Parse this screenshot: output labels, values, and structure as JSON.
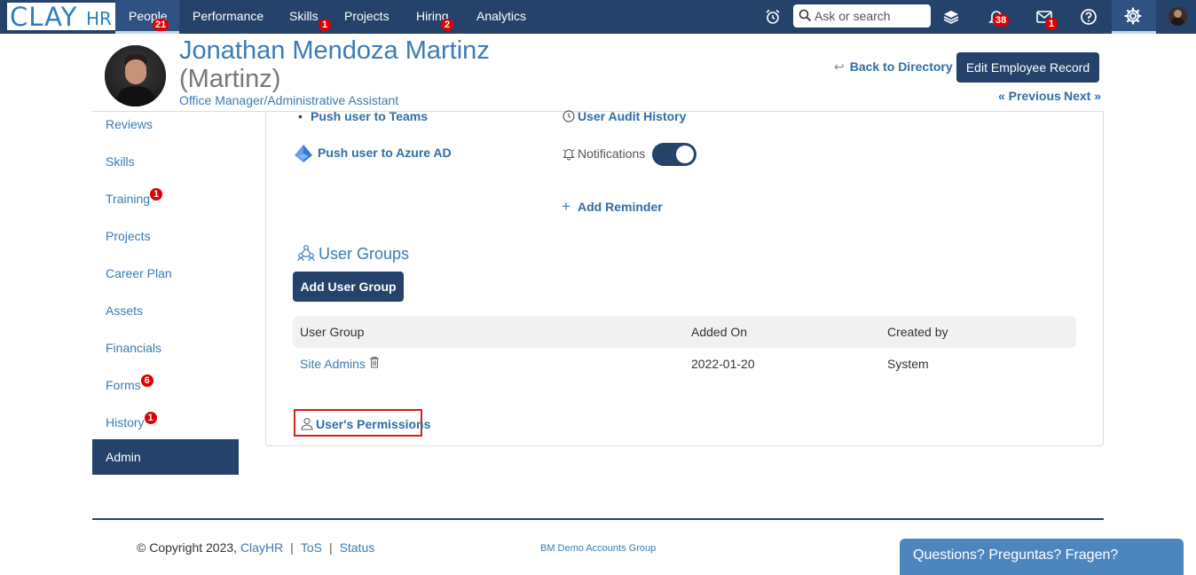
{
  "brand": {
    "clay": "CLAY",
    "hr": "HR"
  },
  "nav": {
    "items": [
      {
        "label": "People",
        "badge": "21"
      },
      {
        "label": "Performance",
        "badge": ""
      },
      {
        "label": "Skills",
        "badge": "1"
      },
      {
        "label": "Projects",
        "badge": ""
      },
      {
        "label": "Hiring",
        "badge": "2"
      },
      {
        "label": "Analytics",
        "badge": ""
      }
    ],
    "search_placeholder": "Ask or search",
    "notifications_badge": "38",
    "messages_badge": "1"
  },
  "employee": {
    "name": "Jonathan Mendoza Martinz",
    "nickname": "(Martinz)",
    "title": "Office Manager/Administrative Assistant"
  },
  "header_actions": {
    "back": "Back to Directory",
    "edit": "Edit Employee Record",
    "previous": "« Previous",
    "next": "Next »"
  },
  "sidebar": {
    "items": [
      {
        "label": "Reviews",
        "badge": ""
      },
      {
        "label": "Skills",
        "badge": ""
      },
      {
        "label": "Training",
        "badge": "1"
      },
      {
        "label": "Projects",
        "badge": ""
      },
      {
        "label": "Career Plan",
        "badge": ""
      },
      {
        "label": "Assets",
        "badge": ""
      },
      {
        "label": "Financials",
        "badge": ""
      },
      {
        "label": "Forms",
        "badge": "6"
      },
      {
        "label": "History",
        "badge": "1"
      },
      {
        "label": "Admin",
        "badge": ""
      }
    ]
  },
  "admin": {
    "push_teams": "Push user to Teams",
    "push_azure": "Push user to Azure AD",
    "audit_history": "User Audit History",
    "notifications": "Notifications",
    "notifications_on": true,
    "add_reminder": "Add Reminder",
    "user_groups_title": "User Groups",
    "add_user_group": "Add User Group",
    "table": {
      "headers": [
        "User Group",
        "Added On",
        "Created by"
      ],
      "rows": [
        {
          "group": "Site Admins",
          "added_on": "2022-01-20",
          "created_by": "System"
        }
      ]
    },
    "permissions": "User's Permissions"
  },
  "footer": {
    "copyright": "© Copyright 2023,",
    "company": "ClayHR",
    "tos": "ToS",
    "status": "Status",
    "group": "BM Demo Accounts Group"
  },
  "chat": {
    "label": "Questions? Preguntas? Fragen?"
  },
  "colors": {
    "primary": "#24426a",
    "link": "#3b7bb5",
    "badge": "#e00000"
  }
}
